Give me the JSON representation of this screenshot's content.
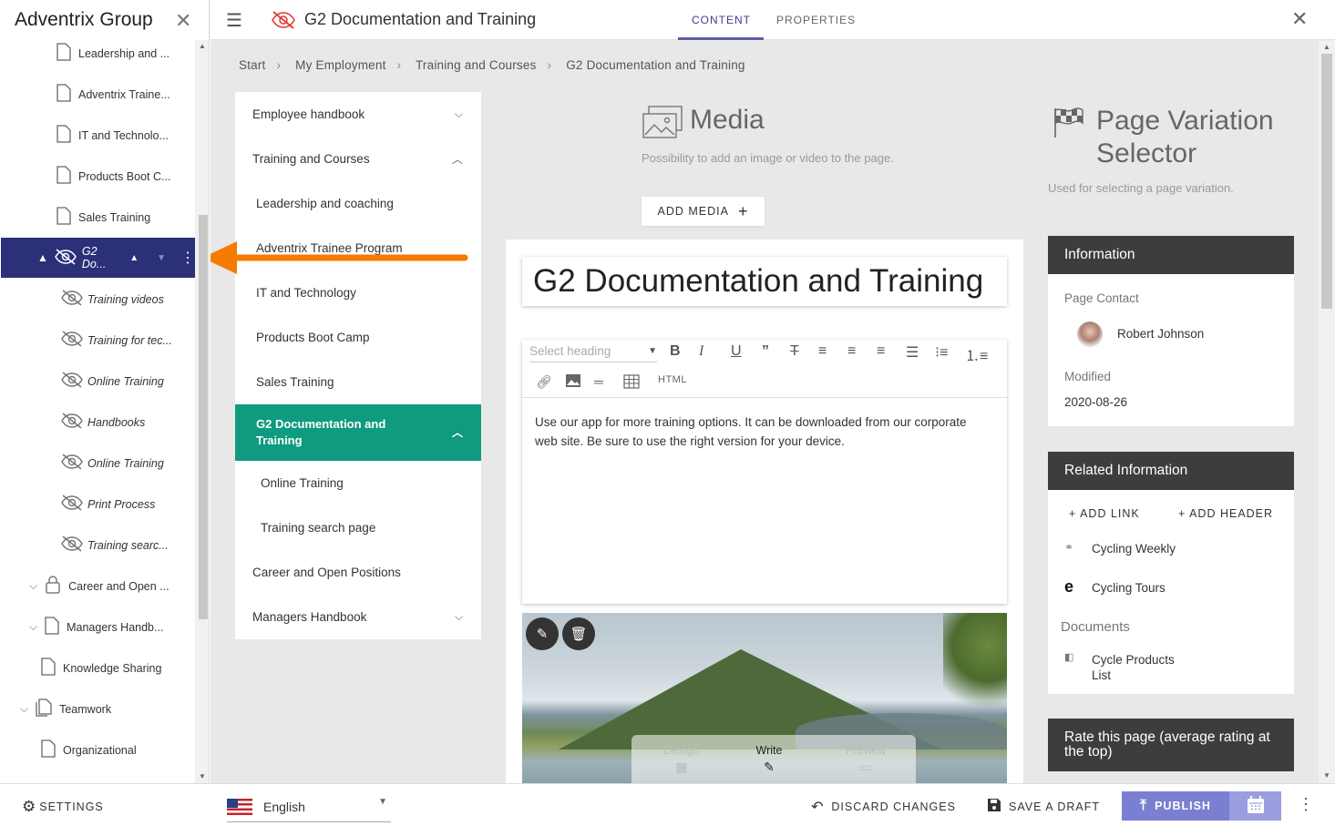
{
  "tree": {
    "brand": "Adventrix Group",
    "items": [
      {
        "label": "Leadership and ..."
      },
      {
        "label": "Adventrix Traine..."
      },
      {
        "label": "IT and Technolo..."
      },
      {
        "label": "Products Boot C..."
      },
      {
        "label": "Sales Training"
      }
    ],
    "selected": "G2 Do...",
    "children": [
      {
        "label": "Training videos"
      },
      {
        "label": "Training for tec..."
      },
      {
        "label": "Online Training"
      },
      {
        "label": "Handbooks"
      },
      {
        "label": "Online Training"
      },
      {
        "label": "Print Process"
      },
      {
        "label": "Training searc..."
      }
    ],
    "siblings": [
      {
        "label": "Career and Open ..."
      },
      {
        "label": "Managers Handb..."
      },
      {
        "label": "Knowledge Sharing"
      },
      {
        "label": "Teamwork"
      },
      {
        "label": "Organizational"
      }
    ]
  },
  "topbar": {
    "title": "G2 Documentation and Training",
    "tabs": [
      "CONTENT",
      "PROPERTIES"
    ]
  },
  "breadcrumb": [
    "Start",
    "My Employment",
    "Training and Courses",
    "G2 Documentation and Training"
  ],
  "nav": {
    "items": [
      {
        "label": "Employee handbook"
      },
      {
        "label": "Training and Courses"
      },
      {
        "label": "Leadership and coaching"
      },
      {
        "label": "Adventrix Trainee Program"
      },
      {
        "label": "IT and Technology"
      },
      {
        "label": "Products Boot Camp"
      },
      {
        "label": "Sales Training"
      },
      {
        "label": "G2 Documentation and Training"
      },
      {
        "label": "Online Training"
      },
      {
        "label": "Training search page"
      },
      {
        "label": "Career and Open Positions"
      },
      {
        "label": "Managers Handbook"
      }
    ]
  },
  "media": {
    "title": "Media",
    "description": "Possibility to add an image or video to the page.",
    "button": "ADD MEDIA"
  },
  "page_variation": {
    "title": "Page Variation Selector",
    "description": "Used for selecting a page variation."
  },
  "editor": {
    "page_title": "G2 Documentation and Training",
    "heading_placeholder": "Select heading",
    "html_label": "HTML",
    "body": "Use our app for more training options. It can be downloaded from our corporate web site. Be sure to use the right version for your device.",
    "modes": [
      "Design",
      "Write",
      "Preview"
    ]
  },
  "info": {
    "header": "Information",
    "contact_label": "Page Contact",
    "contact_name": "Robert Johnson",
    "modified_label": "Modified",
    "modified_value": "2020-08-26"
  },
  "related": {
    "header": "Related Information",
    "add_link": "ADD LINK",
    "add_header": "ADD HEADER",
    "links": [
      "Cycling Weekly",
      "Cycling Tours"
    ],
    "documents_label": "Documents",
    "documents": [
      "Cycle Products List"
    ]
  },
  "rate": {
    "header": "Rate this page (average rating at the top)"
  },
  "bottom": {
    "settings": "SETTINGS",
    "language": "English",
    "discard": "DISCARD CHANGES",
    "save_draft": "SAVE A DRAFT",
    "publish": "PUBLISH"
  },
  "colors": {
    "selected_tree": "#2c3079",
    "active_nav": "#0f9b7f",
    "card_header": "#3d3d3f",
    "publish": "#7b7fd1",
    "arrow": "#f57c00",
    "accent": "#5b5ea8"
  }
}
